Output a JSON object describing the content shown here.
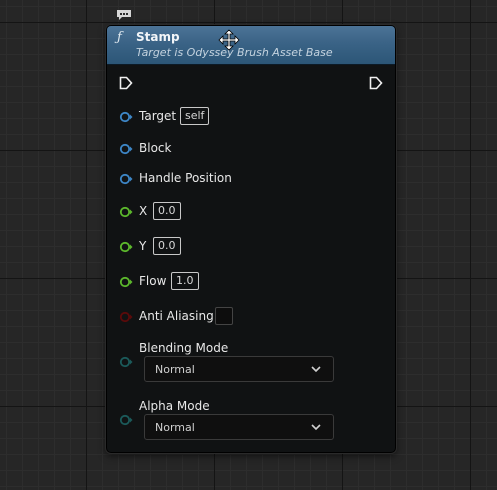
{
  "node": {
    "title": "Stamp",
    "subtitle": "Target is Odyssey Brush Asset Base",
    "header_color": "#3a6386"
  },
  "pins": {
    "target": {
      "label": "Target",
      "value": "self",
      "color": "#3d86c6"
    },
    "block": {
      "label": "Block",
      "color": "#3d86c6"
    },
    "handle_position": {
      "label": "Handle Position",
      "color": "#3d86c6"
    },
    "x": {
      "label": "X",
      "value": "0.0",
      "color": "#5cb82c"
    },
    "y": {
      "label": "Y",
      "value": "0.0",
      "color": "#5cb82c"
    },
    "flow": {
      "label": "Flow",
      "value": "1.0",
      "color": "#5cb82c"
    },
    "anti_aliasing": {
      "label": "Anti Aliasing",
      "checked": false,
      "color": "#6b0000"
    },
    "blending_mode": {
      "label": "Blending Mode",
      "value": "Normal",
      "color": "#1b5a5a"
    },
    "alpha_mode": {
      "label": "Alpha Mode",
      "value": "Normal",
      "color": "#1b5a5a"
    }
  },
  "icons": {
    "comment": "comment-bubble-icon",
    "function": "function-icon",
    "cursor": "move-cursor-icon",
    "exec_in": "exec-input-pin-icon",
    "exec_out": "exec-output-pin-icon",
    "dropdown": "chevron-down-icon"
  }
}
